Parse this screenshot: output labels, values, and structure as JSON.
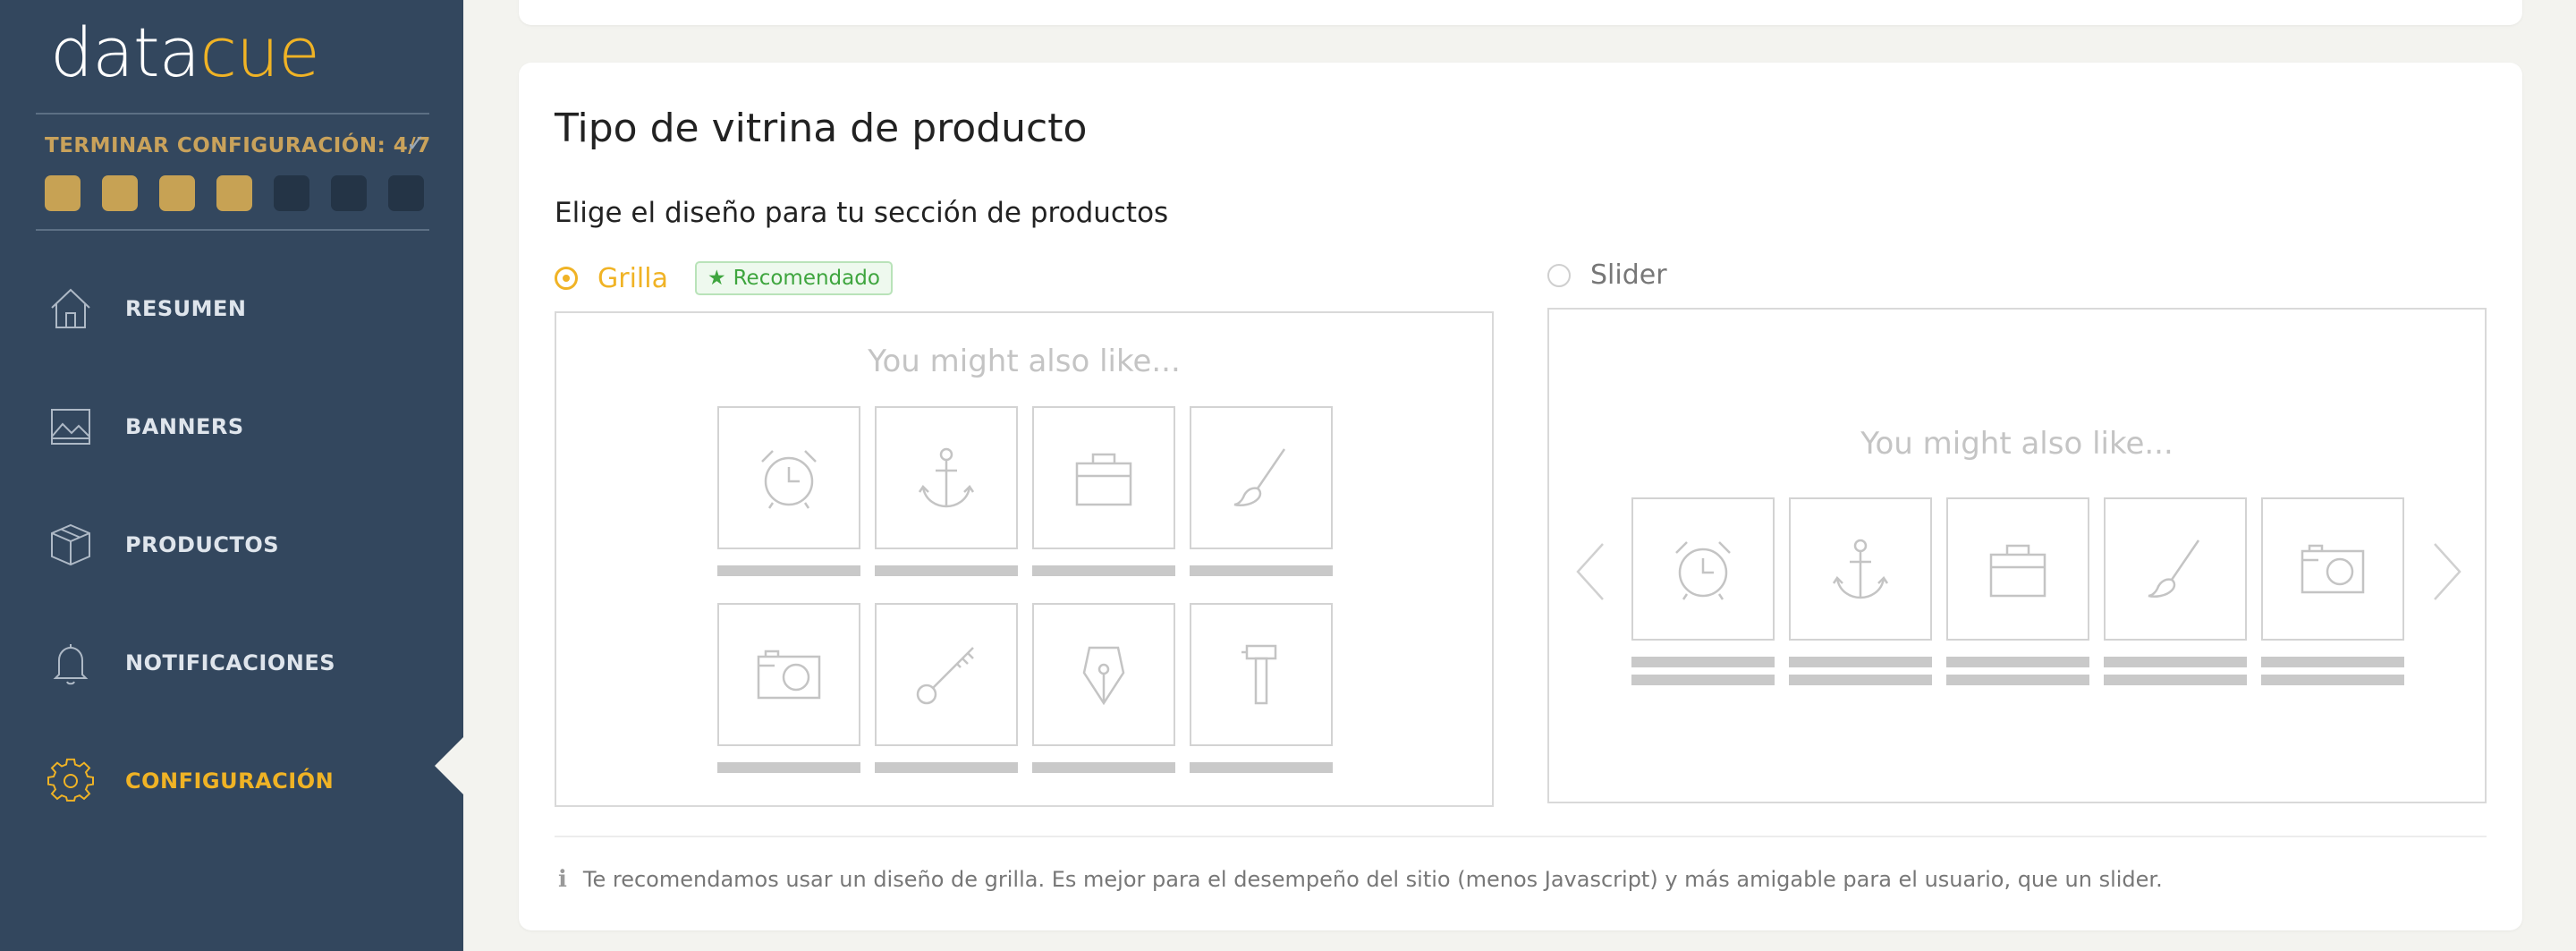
{
  "brand": {
    "part1": "data",
    "part2": "cue"
  },
  "setup": {
    "label": "TERMINAR CONFIGURACIÓN:",
    "progress": "4/7",
    "completed_steps": 4,
    "total_steps": 7
  },
  "nav": [
    {
      "label": "RESUMEN",
      "icon": "home-icon"
    },
    {
      "label": "BANNERS",
      "icon": "image-icon"
    },
    {
      "label": "PRODUCTOS",
      "icon": "box-icon"
    },
    {
      "label": "NOTIFICACIONES",
      "icon": "bell-icon"
    },
    {
      "label": "CONFIGURACIÓN",
      "icon": "gear-icon",
      "active": true
    }
  ],
  "section": {
    "title": "Tipo de vitrina de producto",
    "subtitle": "Elige el diseño para tu sección de productos",
    "options": {
      "grid": {
        "label": "Grilla",
        "badge": "Recomendado",
        "selected": true
      },
      "slider": {
        "label": "Slider",
        "selected": false
      }
    },
    "preview_heading": "You might also like...",
    "grid_icons": [
      "alarm-clock-icon",
      "anchor-icon",
      "briefcase-icon",
      "brush-icon",
      "camera-icon",
      "key-icon",
      "pen-nib-icon",
      "hammer-icon"
    ],
    "slider_icons": [
      "alarm-clock-icon",
      "anchor-icon",
      "briefcase-icon",
      "brush-icon",
      "camera-icon"
    ],
    "info": "Te recomendamos usar un diseño de grilla. Es mejor para el desempeño del sitio (menos Javascript) y más amigable para el usuario, que un slider."
  },
  "colors": {
    "sidebar": "#33475e",
    "accent": "#f0b325",
    "step_done": "#c7a254",
    "step_todo": "#243446"
  }
}
